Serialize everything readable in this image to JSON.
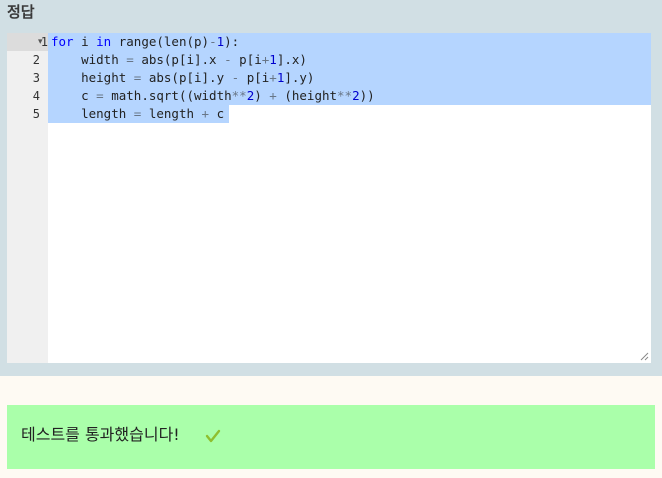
{
  "answer": {
    "title": "정답"
  },
  "editor": {
    "line_numbers": [
      "1",
      "2",
      "3",
      "4",
      "5"
    ],
    "lines": [
      "for i in range(len(p)-1):",
      "    width = abs(p[i].x - p[i+1].x)",
      "    height = abs(p[i].y - p[i+1].y)",
      "    c = math.sqrt((width**2) + (height**2))",
      "    length = length + c"
    ],
    "selection_color": "#b5d5ff"
  },
  "result": {
    "message": "테스트를 통과했습니다!",
    "status_icon": "check-icon",
    "background_color": "#aaffaa",
    "check_color": "#8fbf2f"
  }
}
